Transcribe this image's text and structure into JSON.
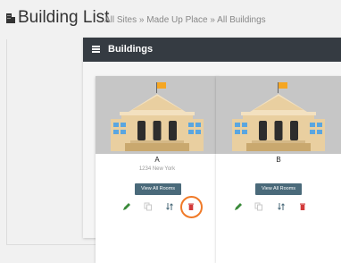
{
  "header": {
    "title": "Building List",
    "breadcrumb": "All Sites » Made Up Place » All Buildings"
  },
  "panel": {
    "title": "Buildings"
  },
  "buildings": [
    {
      "name": "A",
      "address": "1234 New York",
      "view_label": "View All Rooms"
    },
    {
      "name": "B",
      "address": "",
      "view_label": "View All Rooms"
    }
  ],
  "colors": {
    "panel_header": "#353b42",
    "button": "#4a6a7a",
    "edit": "#3a8a3a",
    "delete": "#d23a3a",
    "highlight": "#f07a28"
  },
  "icons": [
    "building-icon",
    "menu-icon",
    "edit-icon",
    "copy-icon",
    "sort-icon",
    "delete-icon"
  ]
}
